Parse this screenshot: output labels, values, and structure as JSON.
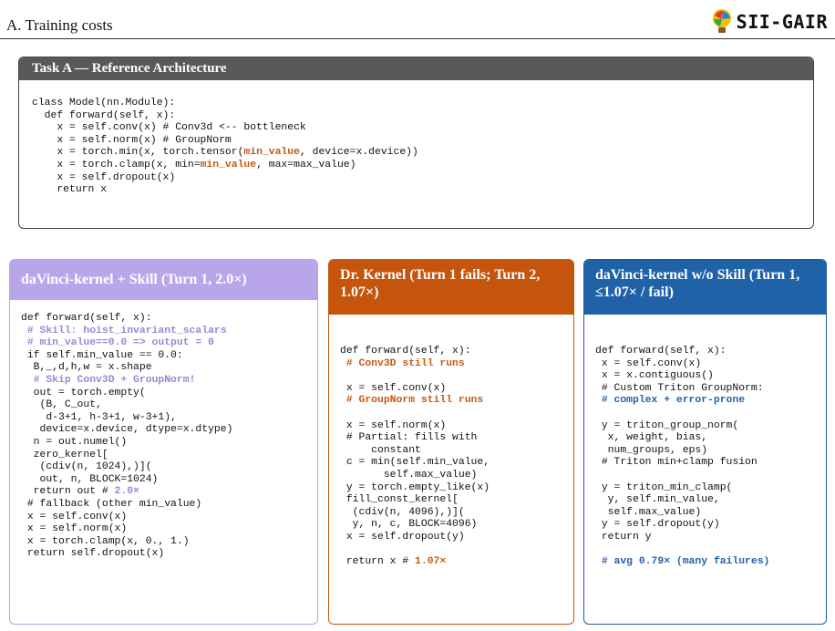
{
  "header": {
    "section_title": "A. Training costs",
    "logo_text": "SII-GAIR"
  },
  "task_a": {
    "title": "Task A — Reference Architecture",
    "lines": {
      "l1": "class Model(nn.Module):",
      "l2": "  def forward(self, x):",
      "l3": "    x = self.conv(x) # Conv3d <-- bottleneck",
      "l4": "    x = self.norm(x) # GroupNorm",
      "l5a": "    x = torch.min(x, torch.tensor(",
      "l5b": "min_value",
      "l5c": ", device=x.device))",
      "l6a": "    x = torch.clamp(x, min=",
      "l6b": "min_value",
      "l6c": ", max=max_value)",
      "l7": "    x = self.dropout(x)",
      "l8": "    return x"
    }
  },
  "davinci_skill": {
    "title": "daVinci-kernel + Skill (Turn 1, 2.0×)",
    "lines": {
      "l1": "def forward(self, x):",
      "l2": " # Skill: hoist_invariant_scalars",
      "l3": " # min_value==0.0 => output = 0",
      "l4": " if self.min_value == 0.0:",
      "l5": "  B,_,d,h,w = x.shape",
      "l6": "  # Skip Conv3D + GroupNorm!",
      "l7": "  out = torch.empty(",
      "l8": "   (B, C_out,",
      "l9": "    d-3+1, h-3+1, w-3+1),",
      "l10": "   device=x.device, dtype=x.dtype)",
      "l11": "  n = out.numel()",
      "l12": "  zero_kernel[",
      "l13": "   (cdiv(n, 1024),)](",
      "l14": "   out, n, BLOCK=1024)",
      "l15a": "  return out # ",
      "l15b": "2.0×",
      "l16": " # fallback (other min_value)",
      "l17": " x = self.conv(x)",
      "l18": " x = self.norm(x)",
      "l19": " x = torch.clamp(x, 0., 1.)",
      "l20": " return self.dropout(x)"
    }
  },
  "dr_kernel": {
    "title": "Dr. Kernel (Turn 1 fails; Turn 2, 1.07×)",
    "lines": {
      "l1": "def forward(self, x):",
      "l2": " # Conv3D still runs",
      "l3": "",
      "l4": " x = self.conv(x)",
      "l5": " # GroupNorm still runs",
      "l6": "",
      "l7": " x = self.norm(x)",
      "l8": " # Partial: fills with",
      "l9": "     constant",
      "l10": " c = min(self.min_value,",
      "l11": "       self.max_value)",
      "l12": " y = torch.empty_like(x)",
      "l13": " fill_const_kernel[",
      "l14": "  (cdiv(n, 4096),)](",
      "l15": "  y, n, c, BLOCK=4096)",
      "l16": " x = self.dropout(y)",
      "l17": "",
      "l18a": " return x # ",
      "l18b": "1.07×"
    }
  },
  "davinci_noskill": {
    "title": "daVinci-kernel w/o Skill (Turn 1, ≤1.07× / fail)",
    "lines": {
      "l1": "def forward(self, x):",
      "l2": " x = self.conv(x)",
      "l3": " x = x.contiguous()",
      "l4": " # Custom Triton GroupNorm:",
      "l5": " # complex + error-prone",
      "l6": "",
      "l7": " y = triton_group_norm(",
      "l8": "  x, weight, bias,",
      "l9": "  num_groups, eps)",
      "l10": " # Triton min+clamp fusion",
      "l11": "",
      "l12": " y = triton_min_clamp(",
      "l13": "  y, self.min_value,",
      "l14": "  self.max_value)",
      "l15": " y = self.dropout(y)",
      "l16": " return y",
      "l17": "",
      "l18": " # avg 0.79× (many failures)"
    }
  },
  "colors": {
    "orange": "#c55a11",
    "purple": "#b9a6ea",
    "blue": "#1f62a8",
    "gray_header": "#595959"
  }
}
